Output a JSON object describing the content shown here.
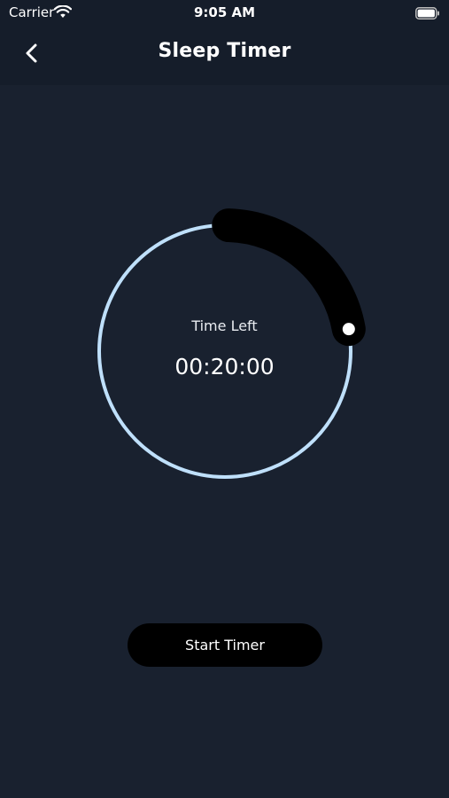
{
  "status_bar": {
    "carrier": "Carrier",
    "time": "9:05 AM",
    "icons": [
      "wifi-icon",
      "battery-icon"
    ]
  },
  "nav": {
    "back_icon": "chevron-left-icon",
    "title": "Sleep Timer"
  },
  "timer": {
    "label": "Time Left",
    "value": "00:20:00",
    "progress_fraction": 0.222
  },
  "actions": {
    "start_label": "Start Timer"
  },
  "colors": {
    "background": "#19212f",
    "header": "#151d2a",
    "ring": "#bfe0fb",
    "progress_arc": "#000000",
    "button": "#000000",
    "text": "#ffffff"
  }
}
